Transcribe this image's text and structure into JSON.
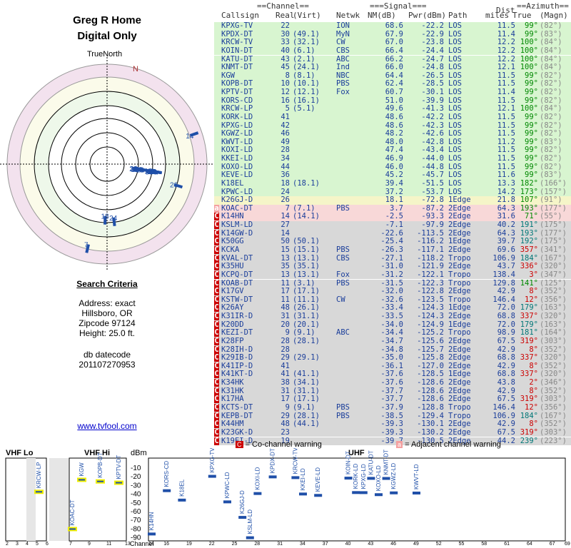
{
  "title": {
    "line1": "Greg R Home",
    "line2": "Digital Only"
  },
  "polar": {
    "north_label": "TrueNorth",
    "magnetic_label": "N"
  },
  "criteria": {
    "heading": "Search Criteria",
    "address": "Address: exact",
    "city": "Hillsboro, OR",
    "zip": "Zipcode 97124",
    "height": "Height: 25.0 ft.",
    "db_label": "db datecode",
    "db_code": "201107270953"
  },
  "link": {
    "text": "www.tvfool.com"
  },
  "table": {
    "group_headers": {
      "channel": "==Channel==",
      "signal": "===Signal===",
      "dist": "Dist",
      "azimuth": "==Azimuth=="
    },
    "headers": [
      "Callsign",
      "Real",
      "(Virt)",
      "Netwk",
      "NM(dB)",
      "Pwr(dBm)",
      "Path",
      "miles",
      "True",
      "(Magn)"
    ],
    "rows": [
      [
        "KPXG-TV",
        "22",
        "",
        "ION",
        "68.6",
        "-22.2",
        "LOS",
        "11.5",
        "99°",
        "(82°)",
        "green",
        ""
      ],
      [
        "KPDX-DT",
        "30",
        "(49.1)",
        "MyN",
        "67.9",
        "-22.9",
        "LOS",
        "11.4",
        "99°",
        "(83°)",
        "green",
        ""
      ],
      [
        "KRCW-TV",
        "33",
        "(32.1)",
        "CW",
        "67.0",
        "-23.8",
        "LOS",
        "12.2",
        "100°",
        "(84°)",
        "green",
        ""
      ],
      [
        "KOIN-DT",
        "40",
        "(6.1)",
        "CBS",
        "66.4",
        "-24.4",
        "LOS",
        "12.2",
        "100°",
        "(84°)",
        "green",
        ""
      ],
      [
        "KATU-DT",
        "43",
        "(2.1)",
        "ABC",
        "66.2",
        "-24.7",
        "LOS",
        "12.2",
        "100°",
        "(84°)",
        "green",
        ""
      ],
      [
        "KNMT-DT",
        "45",
        "(24.1)",
        "Ind",
        "66.0",
        "-24.8",
        "LOS",
        "12.1",
        "100°",
        "(84°)",
        "green",
        ""
      ],
      [
        "KGW",
        "8",
        "(8.1)",
        "NBC",
        "64.4",
        "-26.5",
        "LOS",
        "11.5",
        "99°",
        "(82°)",
        "green",
        ""
      ],
      [
        "KOPB-DT",
        "10",
        "(10.1)",
        "PBS",
        "62.4",
        "-28.5",
        "LOS",
        "11.5",
        "99°",
        "(82°)",
        "green",
        ""
      ],
      [
        "KPTV-DT",
        "12",
        "(12.1)",
        "Fox",
        "60.7",
        "-30.1",
        "LOS",
        "11.4",
        "99°",
        "(82°)",
        "green",
        ""
      ],
      [
        "KORS-CD",
        "16",
        "(16.1)",
        "",
        "51.0",
        "-39.9",
        "LOS",
        "11.5",
        "99°",
        "(82°)",
        "green",
        ""
      ],
      [
        "KRCW-LP",
        "5",
        "(5.1)",
        "",
        "49.6",
        "-41.3",
        "LOS",
        "12.1",
        "100°",
        "(84°)",
        "green",
        ""
      ],
      [
        "KORK-LD",
        "41",
        "",
        "",
        "48.6",
        "-42.2",
        "LOS",
        "11.5",
        "99°",
        "(82°)",
        "green",
        ""
      ],
      [
        "KPXG-LD",
        "42",
        "",
        "",
        "48.6",
        "-42.3",
        "LOS",
        "11.5",
        "99°",
        "(82°)",
        "green",
        ""
      ],
      [
        "KGWZ-LD",
        "46",
        "",
        "",
        "48.2",
        "-42.6",
        "LOS",
        "11.5",
        "99°",
        "(82°)",
        "green",
        ""
      ],
      [
        "KWVT-LD",
        "49",
        "",
        "",
        "48.0",
        "-42.8",
        "LOS",
        "11.2",
        "99°",
        "(83°)",
        "green",
        ""
      ],
      [
        "KOXI-LD",
        "28",
        "",
        "",
        "47.4",
        "-43.4",
        "LOS",
        "11.5",
        "99°",
        "(82°)",
        "green",
        ""
      ],
      [
        "KKEI-LD",
        "34",
        "",
        "",
        "46.9",
        "-44.0",
        "LOS",
        "11.5",
        "99°",
        "(82°)",
        "green",
        ""
      ],
      [
        "KOXO-LD",
        "44",
        "",
        "",
        "46.0",
        "-44.8",
        "LOS",
        "11.5",
        "99°",
        "(82°)",
        "green",
        ""
      ],
      [
        "KEVE-LD",
        "36",
        "",
        "",
        "45.2",
        "-45.7",
        "LOS",
        "11.6",
        "99°",
        "(83°)",
        "green",
        ""
      ],
      [
        "K18EL",
        "18",
        "(18.1)",
        "",
        "39.4",
        "-51.5",
        "LOS",
        "13.3",
        "182°",
        "(166°)",
        "green",
        ""
      ],
      [
        "KPWC-LD",
        "24",
        "",
        "",
        "37.2",
        "-53.7",
        "LOS",
        "14.2",
        "173°",
        "(157°)",
        "green",
        ""
      ],
      [
        "K26GJ-D",
        "26",
        "",
        "",
        "18.1",
        "-72.8",
        "1Edge",
        "21.8",
        "107°",
        "(91°)",
        "yellow",
        ""
      ],
      [
        "KOAC-DT",
        "7",
        "(7.1)",
        "PBS",
        "3.7",
        "-87.2",
        "2Edge",
        "64.3",
        "193°",
        "(177°)",
        "pink",
        "a"
      ],
      [
        "K14HN",
        "14",
        "(14.1)",
        "",
        "-2.5",
        "-93.3",
        "2Edge",
        "31.6",
        "71°",
        "(55°)",
        "pink",
        "C"
      ],
      [
        "KSLM-LD",
        "27",
        "",
        "",
        "-7.1",
        "-97.9",
        "2Edge",
        "40.2",
        "191°",
        "(175°)",
        "grey",
        "C"
      ],
      [
        "K14GW-D",
        "14",
        "",
        "",
        "-22.6",
        "-113.5",
        "2Edge",
        "64.3",
        "193°",
        "(177°)",
        "grey",
        "C"
      ],
      [
        "K50GG",
        "50",
        "(50.1)",
        "",
        "-25.4",
        "-116.2",
        "1Edge",
        "39.7",
        "192°",
        "(175°)",
        "grey",
        "C"
      ],
      [
        "KCKA",
        "15",
        "(15.1)",
        "PBS",
        "-26.3",
        "-117.1",
        "2Edge",
        "69.6",
        "357°",
        "(341°)",
        "grey",
        "C"
      ],
      [
        "KVAL-DT",
        "13",
        "(13.1)",
        "CBS",
        "-27.1",
        "-118.2",
        "Tropo",
        "106.9",
        "184°",
        "(167°)",
        "grey",
        "C"
      ],
      [
        "K35HU",
        "35",
        "(35.1)",
        "",
        "-31.0",
        "-121.9",
        "2Edge",
        "43.7",
        "336°",
        "(320°)",
        "grey",
        "C"
      ],
      [
        "KCPQ-DT",
        "13",
        "(13.1)",
        "Fox",
        "-31.2",
        "-122.1",
        "Tropo",
        "138.4",
        "3°",
        "(347°)",
        "grey",
        "C"
      ],
      [
        "KOAB-DT",
        "11",
        "(3.1)",
        "PBS",
        "-31.5",
        "-122.3",
        "Tropo",
        "129.8",
        "141°",
        "(125°)",
        "grey",
        "C"
      ],
      [
        "K17GV",
        "17",
        "(17.1)",
        "",
        "-32.0",
        "-122.8",
        "2Edge",
        "42.9",
        "8°",
        "(352°)",
        "grey",
        "C"
      ],
      [
        "KSTW-DT",
        "11",
        "(11.1)",
        "CW",
        "-32.6",
        "-123.5",
        "Tropo",
        "146.4",
        "12°",
        "(356°)",
        "grey",
        "C"
      ],
      [
        "K26AY",
        "48",
        "(26.1)",
        "",
        "-33.4",
        "-124.3",
        "1Edge",
        "72.0",
        "179°",
        "(163°)",
        "grey",
        "C"
      ],
      [
        "K31IR-D",
        "31",
        "(31.1)",
        "",
        "-33.5",
        "-124.3",
        "2Edge",
        "68.8",
        "337°",
        "(320°)",
        "grey",
        "C"
      ],
      [
        "K20DD",
        "20",
        "(20.1)",
        "",
        "-34.0",
        "-124.9",
        "1Edge",
        "72.0",
        "179°",
        "(163°)",
        "grey",
        "C"
      ],
      [
        "KEZI-DT",
        "9",
        "(9.1)",
        "ABC",
        "-34.4",
        "-125.2",
        "Tropo",
        "98.9",
        "181°",
        "(164°)",
        "grey",
        "C"
      ],
      [
        "K28FP",
        "28",
        "(28.1)",
        "",
        "-34.7",
        "-125.6",
        "2Edge",
        "67.5",
        "319°",
        "(303°)",
        "grey",
        "C"
      ],
      [
        "K28IH-D",
        "28",
        "",
        "",
        "-34.8",
        "-125.7",
        "2Edge",
        "42.9",
        "8°",
        "(352°)",
        "grey",
        "C"
      ],
      [
        "K29IB-D",
        "29",
        "(29.1)",
        "",
        "-35.0",
        "-125.8",
        "2Edge",
        "68.8",
        "337°",
        "(320°)",
        "grey",
        "C"
      ],
      [
        "K41IP-D",
        "41",
        "",
        "",
        "-36.1",
        "-127.0",
        "2Edge",
        "42.9",
        "8°",
        "(352°)",
        "grey",
        "C"
      ],
      [
        "K41KT-D",
        "41",
        "(41.1)",
        "",
        "-37.6",
        "-128.5",
        "1Edge",
        "68.8",
        "337°",
        "(320°)",
        "grey",
        "C"
      ],
      [
        "K34HK",
        "38",
        "(34.1)",
        "",
        "-37.6",
        "-128.6",
        "2Edge",
        "43.8",
        "2°",
        "(346°)",
        "grey",
        "C"
      ],
      [
        "K31HK",
        "31",
        "(31.1)",
        "",
        "-37.7",
        "-128.6",
        "2Edge",
        "42.9",
        "8°",
        "(352°)",
        "grey",
        "C"
      ],
      [
        "K17HA",
        "17",
        "(17.1)",
        "",
        "-37.7",
        "-128.6",
        "2Edge",
        "67.5",
        "319°",
        "(303°)",
        "grey",
        "C"
      ],
      [
        "KCTS-DT",
        "9",
        "(9.1)",
        "PBS",
        "-37.9",
        "-128.8",
        "Tropo",
        "146.4",
        "12°",
        "(356°)",
        "grey",
        "C"
      ],
      [
        "KEPB-DT",
        "29",
        "(28.1)",
        "PBS",
        "-38.5",
        "-129.4",
        "Tropo",
        "106.9",
        "184°",
        "(167°)",
        "grey",
        "C"
      ],
      [
        "K44HM",
        "48",
        "(44.1)",
        "",
        "-39.3",
        "-130.1",
        "2Edge",
        "42.9",
        "8°",
        "(352°)",
        "grey",
        "C"
      ],
      [
        "K23GK-D",
        "23",
        "",
        "",
        "-39.3",
        "-130.2",
        "2Edge",
        "67.5",
        "319°",
        "(303°)",
        "grey",
        "C"
      ],
      [
        "K19EI-D",
        "19",
        "",
        "",
        "-39.7",
        "-130.5",
        "2Edge",
        "44.2",
        "239°",
        "(223°)",
        "grey",
        "C"
      ]
    ]
  },
  "legend": {
    "c_marker": "C",
    "c_text": "= Co-channel warning",
    "a_marker": "a",
    "a_text": "= Adjacent channel warning"
  },
  "spectrum": {
    "vhf_lo_label": "VHF Lo",
    "vhf_hi_label": "VHF Hi",
    "uhf_label": "UHF",
    "dbm_label": "dBm",
    "channel_label": "Channel",
    "dbm_ticks": [
      "-10",
      "-20",
      "-30",
      "-40",
      "-50",
      "-60",
      "-70",
      "-80",
      "-90"
    ],
    "vhf_lo_ch": [
      "2",
      "3",
      "4",
      "5",
      "6"
    ],
    "vhf_hi_ch": [
      "7",
      "9",
      "11",
      "13"
    ],
    "uhf_ch": [
      "14",
      "16",
      "19",
      "22",
      "25",
      "28",
      "31",
      "34",
      "37",
      "40",
      "43",
      "46",
      "49",
      "52",
      "55",
      "58",
      "61",
      "64",
      "67",
      "69"
    ],
    "stations": [
      {
        "name": "KRCW-LP",
        "ch": 5,
        "pwr": -41.3,
        "sel": true
      },
      {
        "name": "KGW",
        "ch": 8,
        "pwr": -26.5,
        "sel": true
      },
      {
        "name": "KOPB-DT",
        "ch": 10,
        "pwr": -28.5,
        "sel": true
      },
      {
        "name": "KPTV-DT",
        "ch": 12,
        "pwr": -30.1,
        "sel": true
      },
      {
        "name": "KOAC-DT",
        "ch": 7,
        "pwr": -87.2,
        "sel": true
      },
      {
        "name": "K14HN",
        "ch": 14,
        "pwr": -93.3,
        "sel": false
      },
      {
        "name": "KORS-CD",
        "ch": 16,
        "pwr": -39.9,
        "sel": false
      },
      {
        "name": "K18EL",
        "ch": 18,
        "pwr": -51.5,
        "sel": false
      },
      {
        "name": "KPXG-TV",
        "ch": 22,
        "pwr": -22.2,
        "sel": false
      },
      {
        "name": "KPWC-LD",
        "ch": 24,
        "pwr": -53.7,
        "sel": false
      },
      {
        "name": "K26GJ-D",
        "ch": 26,
        "pwr": -72.8,
        "sel": false
      },
      {
        "name": "KSLM-LD",
        "ch": 27,
        "pwr": -97.9,
        "sel": false
      },
      {
        "name": "KOXI-LD",
        "ch": 28,
        "pwr": -43.4,
        "sel": false
      },
      {
        "name": "KPDX-DT",
        "ch": 30,
        "pwr": -22.9,
        "sel": false
      },
      {
        "name": "KRCW-TV",
        "ch": 33,
        "pwr": -23.8,
        "sel": false
      },
      {
        "name": "KKEI-LD",
        "ch": 34,
        "pwr": -44.0,
        "sel": false
      },
      {
        "name": "KEVE-LD",
        "ch": 36,
        "pwr": -45.7,
        "sel": false
      },
      {
        "name": "KOIN-DT",
        "ch": 40,
        "pwr": -24.4,
        "sel": false
      },
      {
        "name": "KORK-LD",
        "ch": 41,
        "pwr": -42.2,
        "sel": false
      },
      {
        "name": "KPXG-LD",
        "ch": 42,
        "pwr": -42.3,
        "sel": false
      },
      {
        "name": "KATU-DT",
        "ch": 43,
        "pwr": -24.7,
        "sel": false
      },
      {
        "name": "KOXO-LD",
        "ch": 44,
        "pwr": -44.8,
        "sel": false
      },
      {
        "name": "KNMT-DT",
        "ch": 45,
        "pwr": -24.8,
        "sel": false
      },
      {
        "name": "KGWZ-LD",
        "ch": 46,
        "pwr": -42.6,
        "sel": false
      },
      {
        "name": "KWVT-LD",
        "ch": 49,
        "pwr": -42.8,
        "sel": false
      }
    ]
  },
  "colors": {
    "green": "#d8f5d0",
    "yellow": "#f5f5c8",
    "pink": "#f8d8d8",
    "grey": "#d8d8d8",
    "azimuth_true": "#0a0",
    "warning_red": "#c00"
  }
}
